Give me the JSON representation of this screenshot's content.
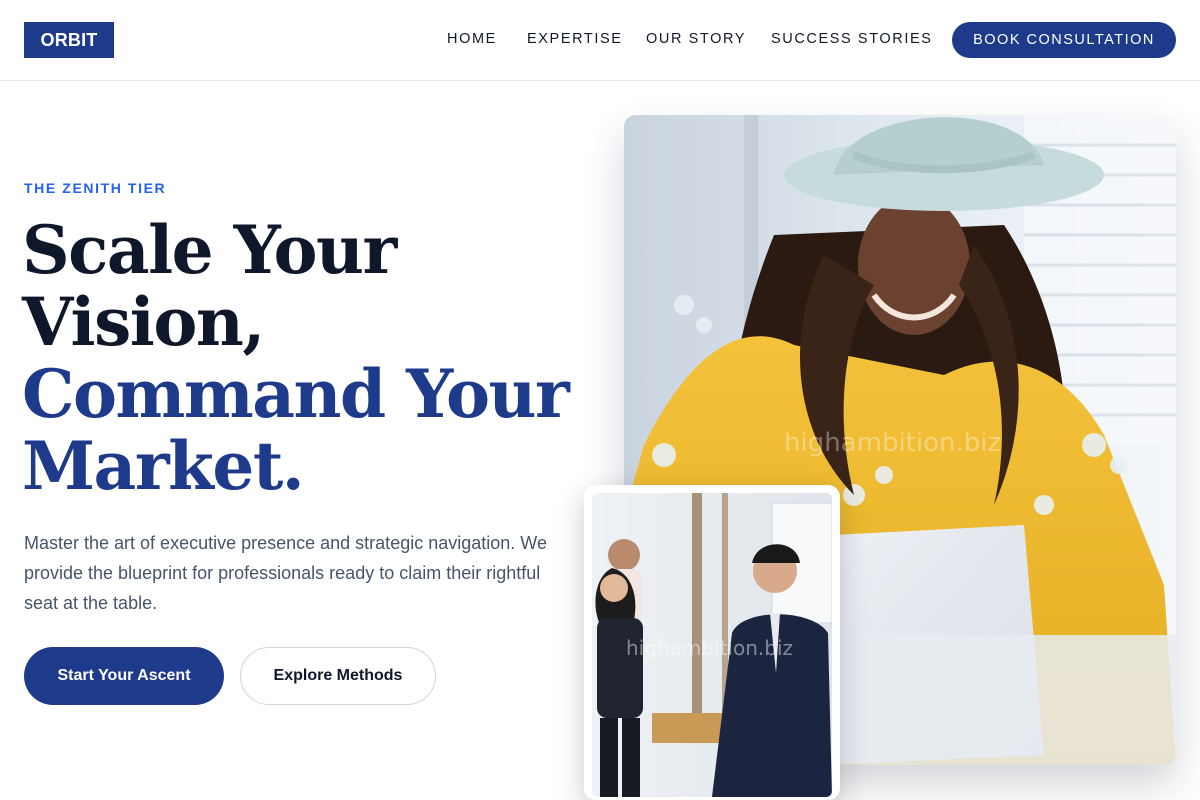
{
  "brand": {
    "logo": "ORBIT",
    "accent": "#1e3a8a",
    "eyebrow_color": "#2563eb"
  },
  "nav": {
    "items": [
      {
        "label": "HOME"
      },
      {
        "label": "EXPERTISE"
      },
      {
        "label": "OUR STORY"
      },
      {
        "label": "SUCCESS STORIES"
      }
    ],
    "cta": "BOOK CONSULTATION"
  },
  "hero": {
    "eyebrow": "THE ZENITH TIER",
    "headline_line1": "Scale Your",
    "headline_line2": "Vision,",
    "headline_line3": "Command Your",
    "headline_line4": "Market.",
    "lead": "Master the art of executive presence and strategic navigation. We provide the blueprint for professionals ready to claim their rightful seat at the table.",
    "primary_button": "Start Your Ascent",
    "secondary_button": "Explore Methods"
  },
  "images": {
    "main_watermark": "highambition.biz",
    "secondary_watermark": "highambition.biz"
  }
}
